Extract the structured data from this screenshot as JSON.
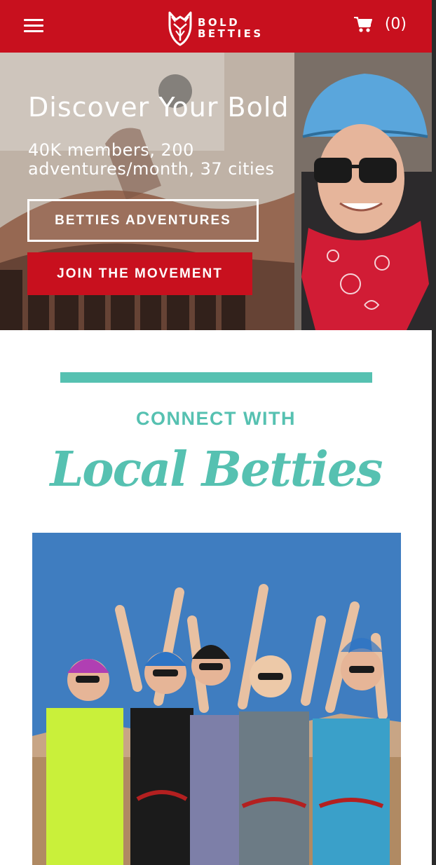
{
  "header": {
    "logo_line1": "BOLD",
    "logo_line2": "BETTIES",
    "cart_count": "(0)",
    "menu_icon": "hamburger-menu-icon",
    "cart_icon": "shopping-cart-icon"
  },
  "hero": {
    "title": "Discover Your Bold",
    "subtitle": "40K members, 200 adventures/month, 37 cities",
    "adventures_button": "BETTIES ADVENTURES",
    "join_button": "JOIN THE MOVEMENT"
  },
  "connect": {
    "label": "CONNECT WITH",
    "script_title": "Local Betties"
  },
  "colors": {
    "brand_red": "#c8101e",
    "teal": "#56c1b1",
    "white": "#ffffff"
  }
}
